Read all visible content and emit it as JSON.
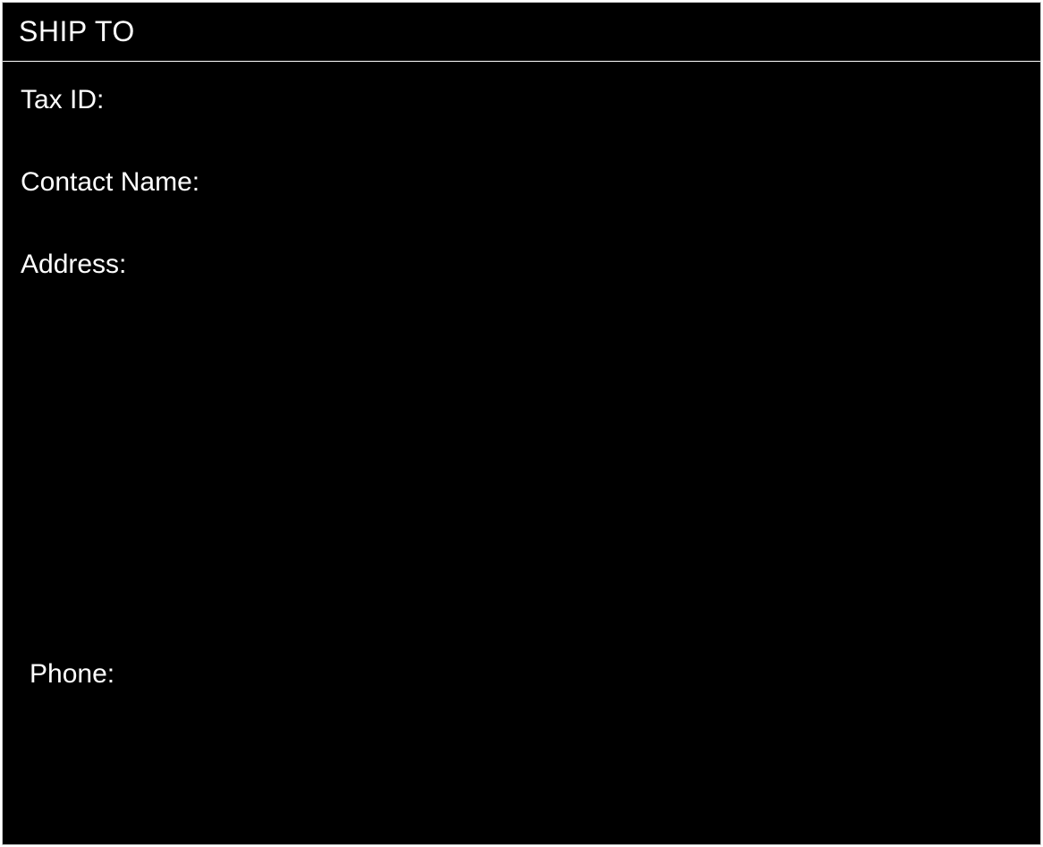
{
  "shipTo": {
    "header": "SHIP TO",
    "fields": {
      "taxId": {
        "label": "Tax ID:",
        "value": ""
      },
      "contactName": {
        "label": "Contact Name:",
        "value": ""
      },
      "address": {
        "label": "Address:",
        "value": ""
      },
      "phone": {
        "label": "Phone:",
        "value": ""
      }
    }
  }
}
